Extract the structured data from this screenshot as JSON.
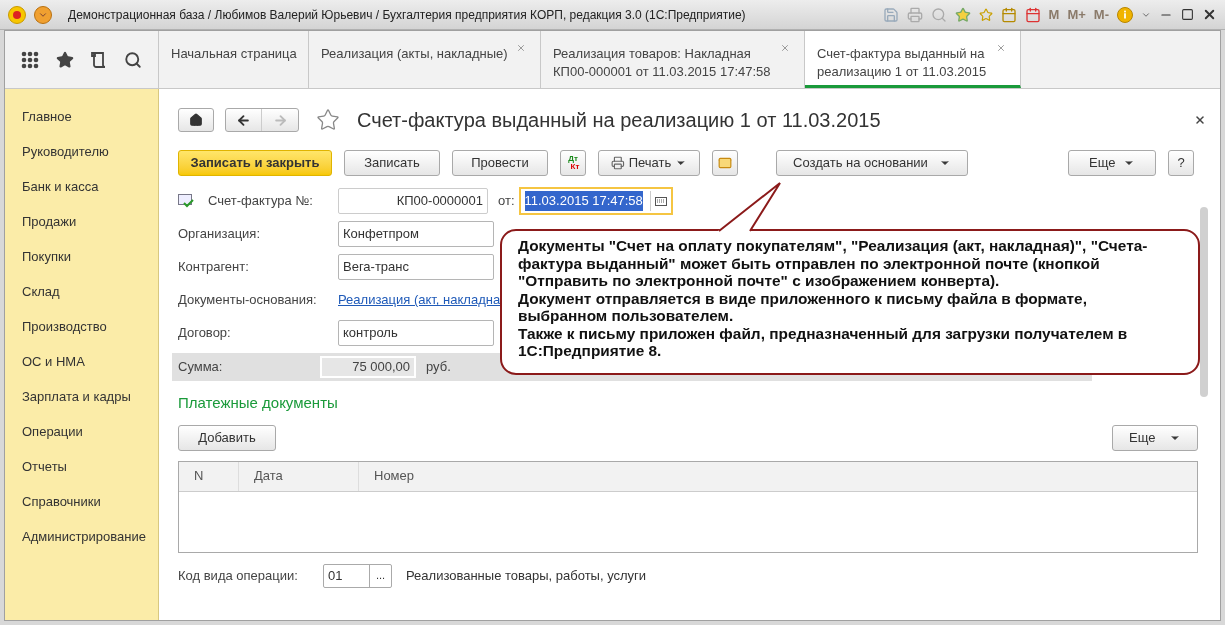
{
  "window": {
    "title": "Демонстрационная база / Любимов Валерий Юрьевич / Бухгалтерия предприятия КОРП, редакция 3.0  (1С:Предприятие)",
    "memory_buttons": [
      "M",
      "M+",
      "M-"
    ]
  },
  "tabs": [
    {
      "label": "Начальная страница",
      "selected": false,
      "closable": false
    },
    {
      "label": "Реализация (акты, накладные)",
      "selected": false,
      "closable": true
    },
    {
      "label": "Реализация товаров: Накладная КП00-000001 от 11.03.2015 17:47:58",
      "selected": false,
      "closable": true
    },
    {
      "label": "Счет-фактура выданный на реализацию 1 от 11.03.2015",
      "selected": true,
      "closable": true
    }
  ],
  "sidebar": {
    "items": [
      {
        "label": "Главное"
      },
      {
        "label": "Руководителю"
      },
      {
        "label": "Банк и касса"
      },
      {
        "label": "Продажи"
      },
      {
        "label": "Покупки"
      },
      {
        "label": "Склад"
      },
      {
        "label": "Производство"
      },
      {
        "label": "ОС и НМА"
      },
      {
        "label": "Зарплата и кадры"
      },
      {
        "label": "Операции"
      },
      {
        "label": "Отчеты"
      },
      {
        "label": "Справочники"
      },
      {
        "label": "Администрирование"
      }
    ]
  },
  "document": {
    "title": "Счет-фактура выданный на реализацию 1 от 11.03.2015",
    "toolbar": [
      {
        "kind": "primary",
        "label": "Записать и закрыть"
      },
      {
        "kind": "plain",
        "label": "Записать"
      },
      {
        "kind": "plain",
        "label": "Провести"
      },
      {
        "kind": "dtkt",
        "label": "Дт",
        "label2": "Кт"
      },
      {
        "kind": "print",
        "label": "Печать"
      },
      {
        "kind": "mail"
      },
      {
        "kind": "dropdown",
        "label": "Создать на основании"
      },
      {
        "kind": "more",
        "label": "Еще"
      },
      {
        "kind": "help",
        "label": "?"
      }
    ],
    "number": {
      "label": "Счет-фактура №:",
      "value": "КП00-0000001",
      "date_label": "от:",
      "date": "11.03.2015 17:47:58",
      "focused": true
    },
    "fields": [
      {
        "kind": "input",
        "label": "Организация:",
        "value": "Конфетпром"
      },
      {
        "kind": "input",
        "label": "Контрагент:",
        "value": "Вега-транс"
      },
      {
        "kind": "link",
        "label": "Документы-основания:",
        "value": "Реализация (акт, накладна"
      },
      {
        "kind": "input",
        "label": "Договор:",
        "value": "контроль"
      }
    ],
    "sum": {
      "label": "Сумма:",
      "value": "75 000,00",
      "currency": "руб."
    },
    "payments": {
      "title": "Платежные документы",
      "add": "Добавить",
      "more": "Еще",
      "columns": [
        "N",
        "Дата",
        "Номер"
      ]
    },
    "operation": {
      "label": "Код вида операции:",
      "code": "01",
      "button": "...",
      "description": "Реализованные товары, работы, услуги"
    }
  },
  "callout": {
    "paragraphs": [
      "Документы \"Счет на оплату покупателям\", \"Реализация (акт, накладная)\", \"Счета-фактура выданный\" может быть отправлен по электронной почте (кнопкой \"Отправить по электронной почте\" с изображением конверта).",
      "Документ отправляется в виде приложенного к письму файла в формате, выбранном пользователем.",
      "Также к письму приложен файл, предназначенный для загрузки получателем в 1С:Предприятие 8."
    ]
  }
}
